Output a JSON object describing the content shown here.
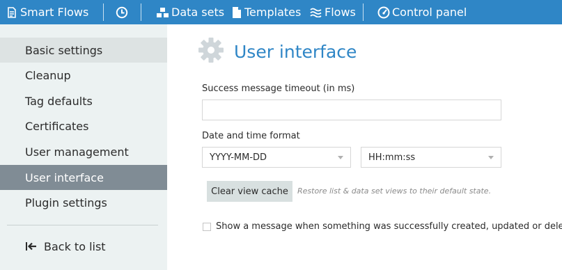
{
  "colors": {
    "accent": "#2f86c6",
    "sidebar_bg": "#ecf2f2",
    "active_item": "#808c95"
  },
  "nav": {
    "brand": "Smart Flows",
    "history_icon": "clock-icon",
    "items": [
      {
        "label": "Data sets",
        "icon": "datasets-icon"
      },
      {
        "label": "Templates",
        "icon": "document-icon"
      },
      {
        "label": "Flows",
        "icon": "waves-icon"
      },
      {
        "label": "Control panel",
        "icon": "gauge-icon"
      }
    ]
  },
  "sidebar": {
    "items": [
      {
        "label": "Basic settings",
        "state": "hover"
      },
      {
        "label": "Cleanup"
      },
      {
        "label": "Tag defaults"
      },
      {
        "label": "Certificates"
      },
      {
        "label": "User management"
      },
      {
        "label": "User interface",
        "state": "active"
      },
      {
        "label": "Plugin settings"
      }
    ],
    "back_label": "Back to list"
  },
  "main": {
    "title": "User interface",
    "title_icon": "gear-icon",
    "timeout_label": "Success message timeout (in ms)",
    "timeout_value": "",
    "datetime_label": "Date and time format",
    "date_format": "YYYY-MM-DD",
    "time_format": "HH:mm:ss",
    "clear_cache_label": "Clear view cache",
    "clear_cache_hint": "Restore list & data set views to their default state.",
    "show_message_label": "Show a message when something was successfully created, updated or deleted.",
    "show_message_checked": false
  }
}
